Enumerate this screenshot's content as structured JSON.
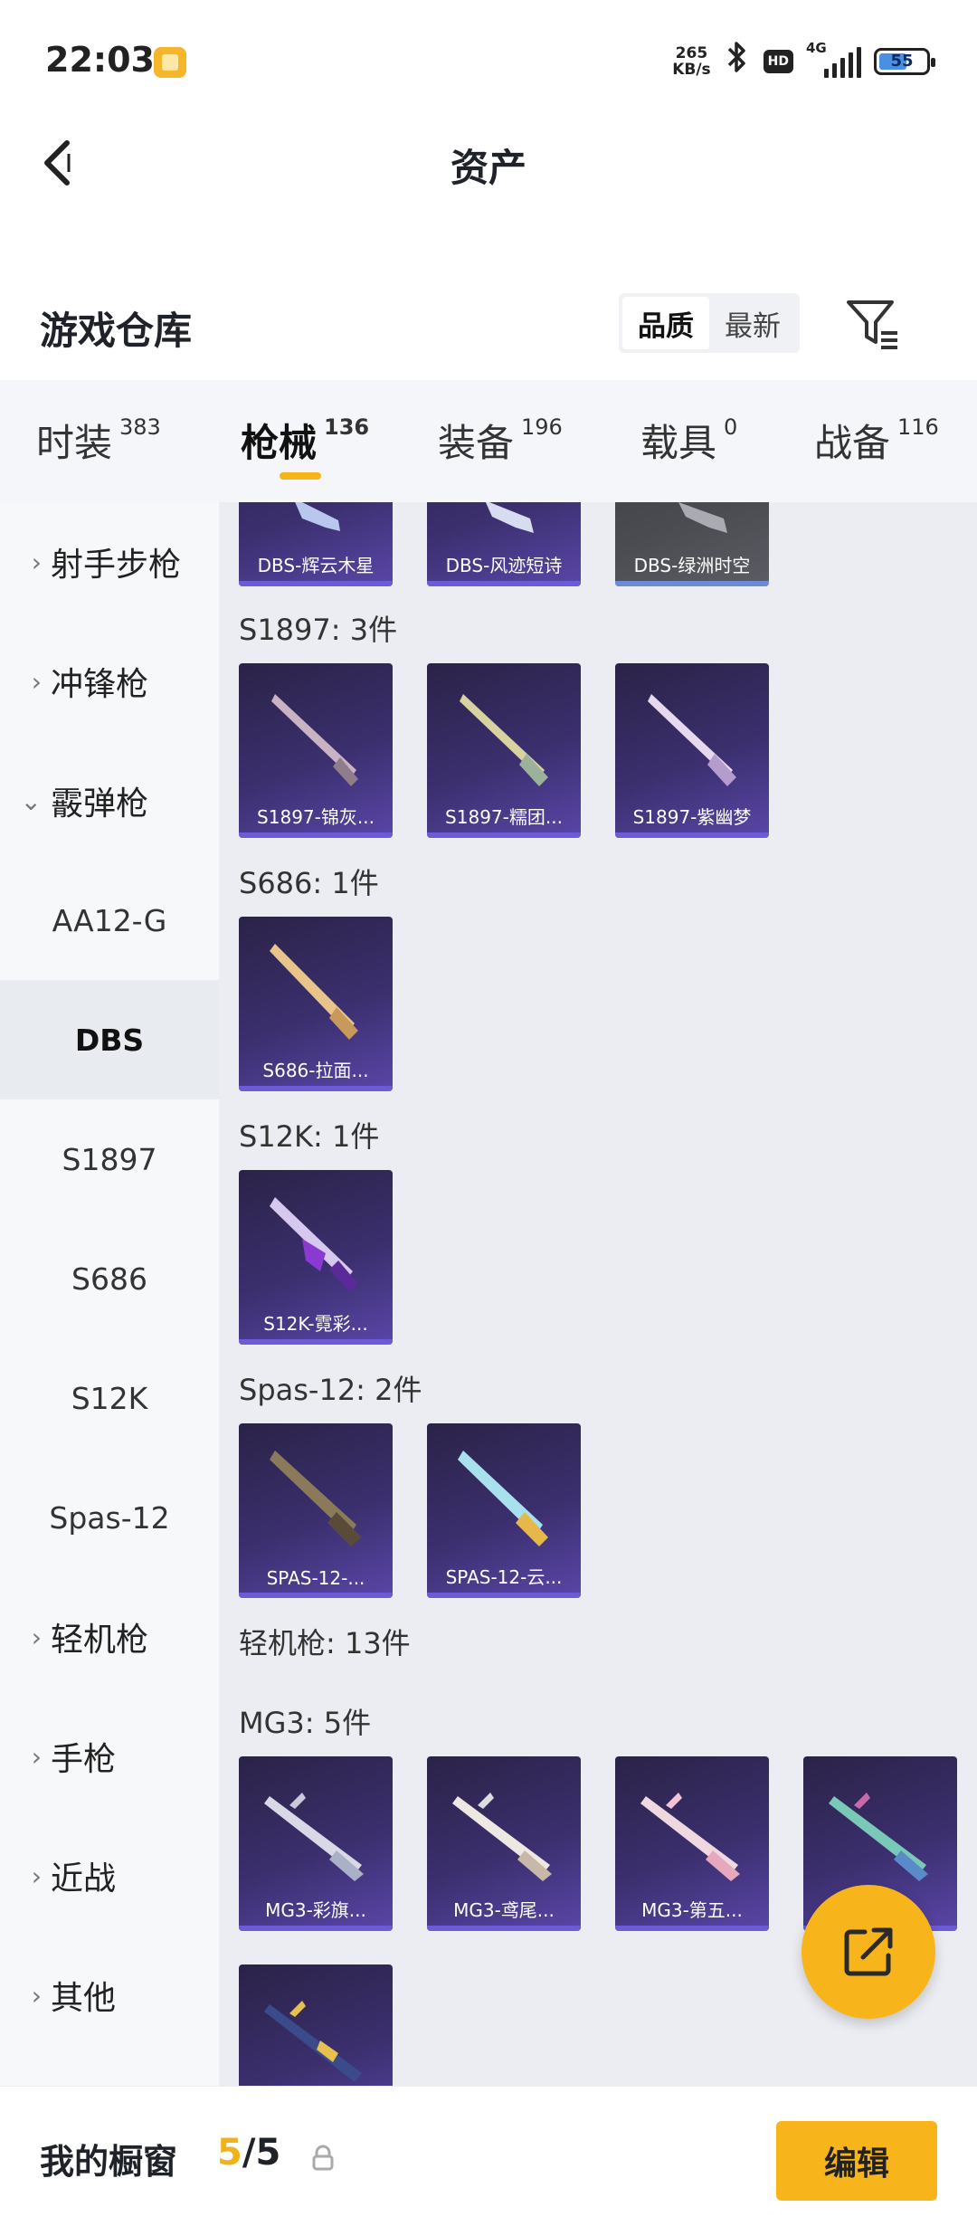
{
  "status_bar": {
    "time": "22:03",
    "net_speed_value": "265",
    "net_speed_unit": "KB/s",
    "hd": "HD",
    "network": "4G",
    "battery": "55"
  },
  "header": {
    "title": "资产"
  },
  "section": {
    "title": "游戏仓库",
    "sort_options": [
      "品质",
      "最新"
    ]
  },
  "tabs": [
    {
      "label": "时装",
      "count": "383"
    },
    {
      "label": "枪械",
      "count": "136"
    },
    {
      "label": "装备",
      "count": "196"
    },
    {
      "label": "载具",
      "count": "0"
    },
    {
      "label": "战备",
      "count": "116"
    }
  ],
  "sidebar": [
    {
      "label": "射手步枪",
      "type": "category"
    },
    {
      "label": "冲锋枪",
      "type": "category"
    },
    {
      "label": "霰弹枪",
      "type": "category-open"
    },
    {
      "label": "AA12-G",
      "type": "sub"
    },
    {
      "label": "DBS",
      "type": "sub-active"
    },
    {
      "label": "S1897",
      "type": "sub"
    },
    {
      "label": "S686",
      "type": "sub"
    },
    {
      "label": "S12K",
      "type": "sub"
    },
    {
      "label": "Spas-12",
      "type": "sub"
    },
    {
      "label": "轻机枪",
      "type": "category"
    },
    {
      "label": "手枪",
      "type": "category"
    },
    {
      "label": "近战",
      "type": "category"
    },
    {
      "label": "其他",
      "type": "category"
    }
  ],
  "groups": [
    {
      "title": "",
      "items": [
        "DBS-辉云木星",
        "DBS-风迹短诗",
        "DBS-绿洲时空"
      ]
    },
    {
      "title": "S1897: 3件",
      "items": [
        "S1897-锦灰...",
        "S1897-糯团...",
        "S1897-紫幽梦"
      ]
    },
    {
      "title": "S686: 1件",
      "items": [
        "S686-拉面..."
      ]
    },
    {
      "title": "S12K: 1件",
      "items": [
        "S12K-霓彩..."
      ]
    },
    {
      "title": "Spas-12: 2件",
      "items": [
        "SPAS-12-...",
        "SPAS-12-云..."
      ]
    },
    {
      "title": "轻机枪: 13件",
      "items": []
    },
    {
      "title": "MG3: 5件",
      "items": [
        "MG3-彩旗...",
        "MG3-鸢尾...",
        "MG3-第五...",
        "",
        ""
      ]
    }
  ],
  "bottom_bar": {
    "title": "我的橱窗",
    "current": "5",
    "total": "/5",
    "edit_label": "编辑"
  },
  "colors": {
    "accent": "#f7b51b",
    "card_purple": "#3b2f6e",
    "card_bar": "#6c5ad8"
  }
}
